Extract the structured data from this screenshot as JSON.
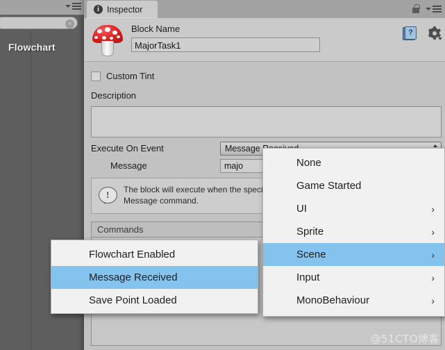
{
  "left_panel": {
    "label": "Flowchart",
    "search_placeholder": "",
    "clear_glyph": "×"
  },
  "inspector": {
    "tab_label": "Inspector",
    "info_glyph": "i",
    "help_glyph": "?"
  },
  "block": {
    "name_label": "Block Name",
    "name_value": "MajorTask1",
    "custom_tint_label": "Custom Tint",
    "description_label": "Description",
    "description_value": "",
    "execute_label": "Execute On Event",
    "execute_value": "Message Received",
    "message_label": "Message",
    "message_value": "majo",
    "help_text": "The block will execute when the specified message is received from a Send Message command.",
    "commands_label": "Commands"
  },
  "event_menu": {
    "items": [
      {
        "label": "None",
        "has_submenu": false,
        "selected": false
      },
      {
        "label": "Game Started",
        "has_submenu": false,
        "selected": false
      },
      {
        "label": "UI",
        "has_submenu": true,
        "selected": false
      },
      {
        "label": "Sprite",
        "has_submenu": true,
        "selected": false
      },
      {
        "label": "Scene",
        "has_submenu": true,
        "selected": true
      },
      {
        "label": "Input",
        "has_submenu": true,
        "selected": false
      },
      {
        "label": "MonoBehaviour",
        "has_submenu": true,
        "selected": false
      }
    ],
    "submenu_arrow": "›"
  },
  "scene_submenu": {
    "items": [
      {
        "label": "Flowchart Enabled",
        "selected": false
      },
      {
        "label": "Message Received",
        "selected": true
      },
      {
        "label": "Save Point Loaded",
        "selected": false
      }
    ]
  },
  "watermark": {
    "text": "@51CTO博客"
  },
  "colors": {
    "accent_highlight": "#85c3ef",
    "panel_bg": "#c2c2c2",
    "popup_bg": "#f1f1f1",
    "scene_bg": "#5e5e5e",
    "mushroom_cap": "#d81f1f"
  }
}
